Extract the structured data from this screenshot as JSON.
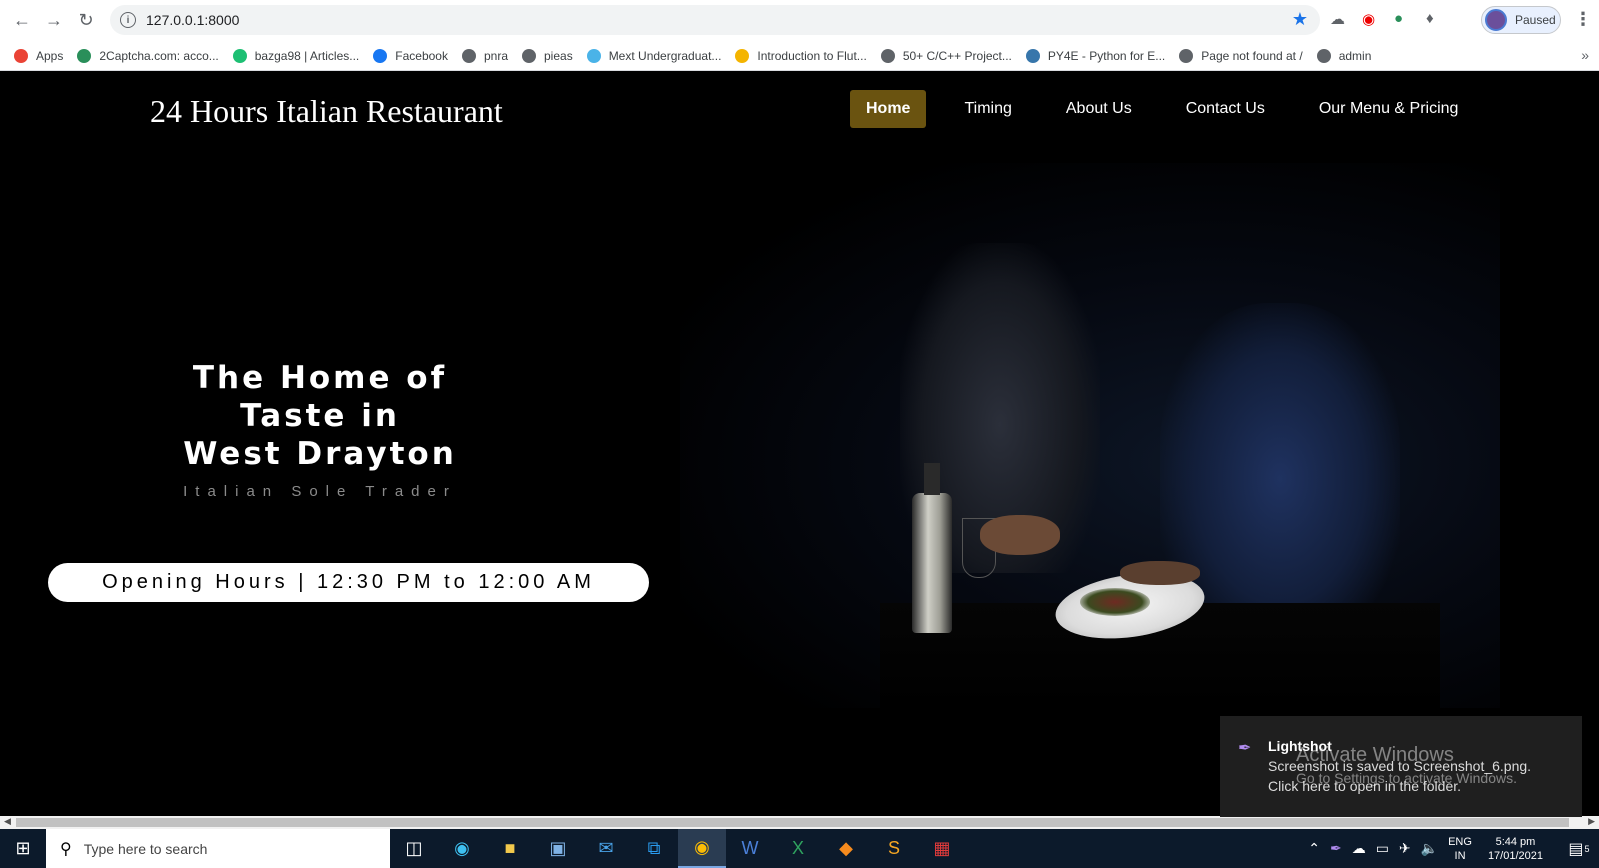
{
  "browser": {
    "url": "127.0.0.1:8000",
    "profile_label": "Paused",
    "bookmarks": [
      {
        "label": "Apps",
        "icon": "apps-grid-icon",
        "color": "#ea4335"
      },
      {
        "label": "2Captcha.com: acco...",
        "icon": "captcha-icon",
        "color": "#2a8f5a"
      },
      {
        "label": "bazga98 | Articles...",
        "icon": "fiverr-icon",
        "color": "#1dbf73"
      },
      {
        "label": "Facebook",
        "icon": "facebook-icon",
        "color": "#1877f2"
      },
      {
        "label": "pnra",
        "icon": "globe-icon",
        "color": "#5f6368"
      },
      {
        "label": "pieas",
        "icon": "globe-icon",
        "color": "#5f6368"
      },
      {
        "label": "Mext Undergraduat...",
        "icon": "dots-icon",
        "color": "#4ab3e8"
      },
      {
        "label": "Introduction to Flut...",
        "icon": "lock-icon",
        "color": "#f4b400"
      },
      {
        "label": "50+ C/C++ Project...",
        "icon": "globe-icon",
        "color": "#5f6368"
      },
      {
        "label": "PY4E - Python for E...",
        "icon": "python-icon",
        "color": "#3776ab"
      },
      {
        "label": "Page not found at /",
        "icon": "globe-icon",
        "color": "#5f6368"
      },
      {
        "label": "admin",
        "icon": "globe-icon",
        "color": "#5f6368"
      }
    ]
  },
  "site": {
    "brand": "24 Hours Italian Restaurant",
    "nav": [
      {
        "label": "Home",
        "active": true
      },
      {
        "label": "Timing"
      },
      {
        "label": "About Us"
      },
      {
        "label": "Contact Us"
      },
      {
        "label": "Our Menu & Pricing"
      }
    ],
    "hero": {
      "title_line1": "The Home of",
      "title_line2": "Taste in",
      "title_line3": "West Drayton",
      "subtitle": "Italian Sole Trader",
      "hours": "Opening Hours | 12:30 PM to 12:00 AM"
    },
    "accent_color": "#6a5310"
  },
  "toast": {
    "app": "Lightshot",
    "line1": "Screenshot is saved to Screenshot_6.png.",
    "line2": "Click here to open in the folder."
  },
  "watermark": {
    "line1": "Activate Windows",
    "line2": "Go to Settings to activate Windows."
  },
  "taskbar": {
    "search_placeholder": "Type here to search",
    "lang_top": "ENG",
    "lang_bottom": "IN",
    "time": "5:44 pm",
    "date": "17/01/2021",
    "notification_count": "5"
  }
}
